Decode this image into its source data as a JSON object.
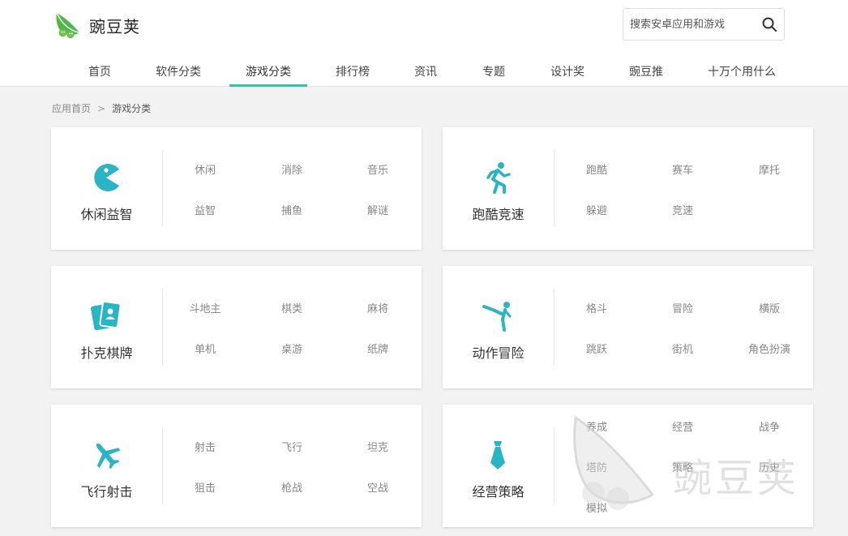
{
  "header": {
    "logo_text": "豌豆荚",
    "search": {
      "placeholder": "搜索安卓应用和游戏"
    },
    "nav": [
      {
        "label": "首页"
      },
      {
        "label": "软件分类"
      },
      {
        "label": "游戏分类",
        "active": true
      },
      {
        "label": "排行榜"
      },
      {
        "label": "资讯"
      },
      {
        "label": "专题"
      },
      {
        "label": "设计奖"
      },
      {
        "label": "豌豆推"
      },
      {
        "label": "十万个用什么"
      }
    ]
  },
  "breadcrumb": {
    "home": "应用首页",
    "separator": ">",
    "current": "游戏分类"
  },
  "accent_color": "#2bb5c4",
  "active_tab_color": "#3dbea5",
  "categories": [
    {
      "title": "休闲益智",
      "icon": "pacman-icon",
      "items": [
        "休闲",
        "消除",
        "音乐",
        "益智",
        "捕鱼",
        "解谜"
      ]
    },
    {
      "title": "跑酷竞速",
      "icon": "runner-icon",
      "items": [
        "跑酷",
        "赛车",
        "摩托",
        "躲避",
        "竞速"
      ]
    },
    {
      "title": "扑克棋牌",
      "icon": "cards-icon",
      "items": [
        "斗地主",
        "棋类",
        "麻将",
        "单机",
        "桌游",
        "纸牌"
      ]
    },
    {
      "title": "动作冒险",
      "icon": "kick-icon",
      "items": [
        "格斗",
        "冒险",
        "横版",
        "跳跃",
        "街机",
        "角色扮演"
      ]
    },
    {
      "title": "飞行射击",
      "icon": "airplane-icon",
      "items": [
        "射击",
        "飞行",
        "坦克",
        "狙击",
        "枪战",
        "空战"
      ]
    },
    {
      "title": "经营策略",
      "icon": "tie-icon",
      "items": [
        "养成",
        "经营",
        "战争",
        "塔防",
        "策略",
        "历史",
        "模拟"
      ]
    }
  ],
  "watermark_text": "豌豆荚"
}
